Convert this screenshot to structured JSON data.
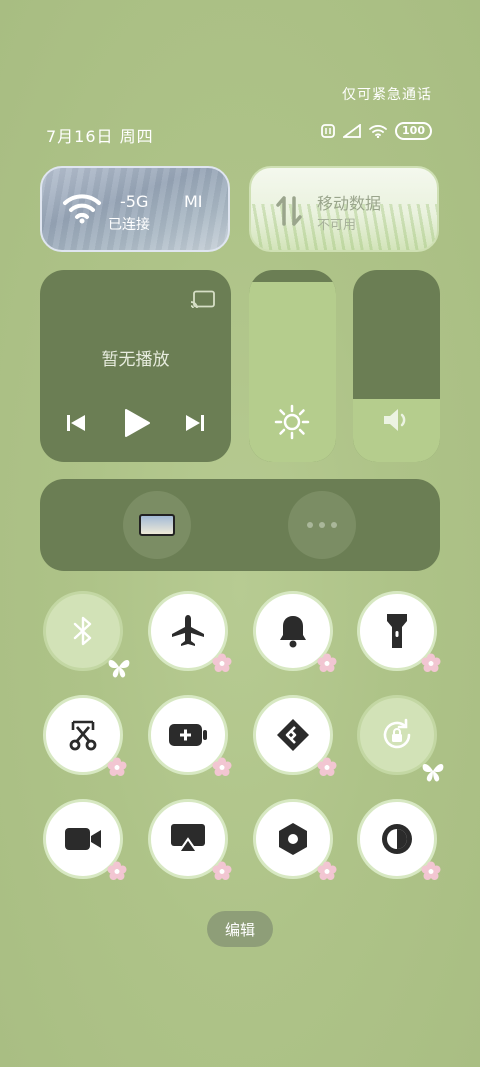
{
  "status_bar": {
    "emergency_note": "仅可紧急通话",
    "date": "7月16日 周四",
    "battery": "100"
  },
  "wifi_tile": {
    "network": "-5G",
    "brand": "MI",
    "state": "已连接"
  },
  "data_tile": {
    "title": "移动数据",
    "state": "不可用"
  },
  "media": {
    "status": "暂无播放"
  },
  "sliders": {
    "brightness_level": 0.94,
    "volume_level": 0.33
  },
  "edit_button": {
    "label": "编辑"
  },
  "toggles": [
    {
      "name": "bluetooth",
      "state": "off"
    },
    {
      "name": "airplane",
      "state": "on"
    },
    {
      "name": "bell",
      "state": "on"
    },
    {
      "name": "flashlight",
      "state": "on"
    },
    {
      "name": "screenshot",
      "state": "on"
    },
    {
      "name": "battery-saver",
      "state": "on"
    },
    {
      "name": "mi-share",
      "state": "on"
    },
    {
      "name": "rotation-lock",
      "state": "off"
    },
    {
      "name": "screen-record",
      "state": "on"
    },
    {
      "name": "cast",
      "state": "on"
    },
    {
      "name": "settings-hex",
      "state": "on"
    },
    {
      "name": "dark-mode",
      "state": "on"
    }
  ]
}
